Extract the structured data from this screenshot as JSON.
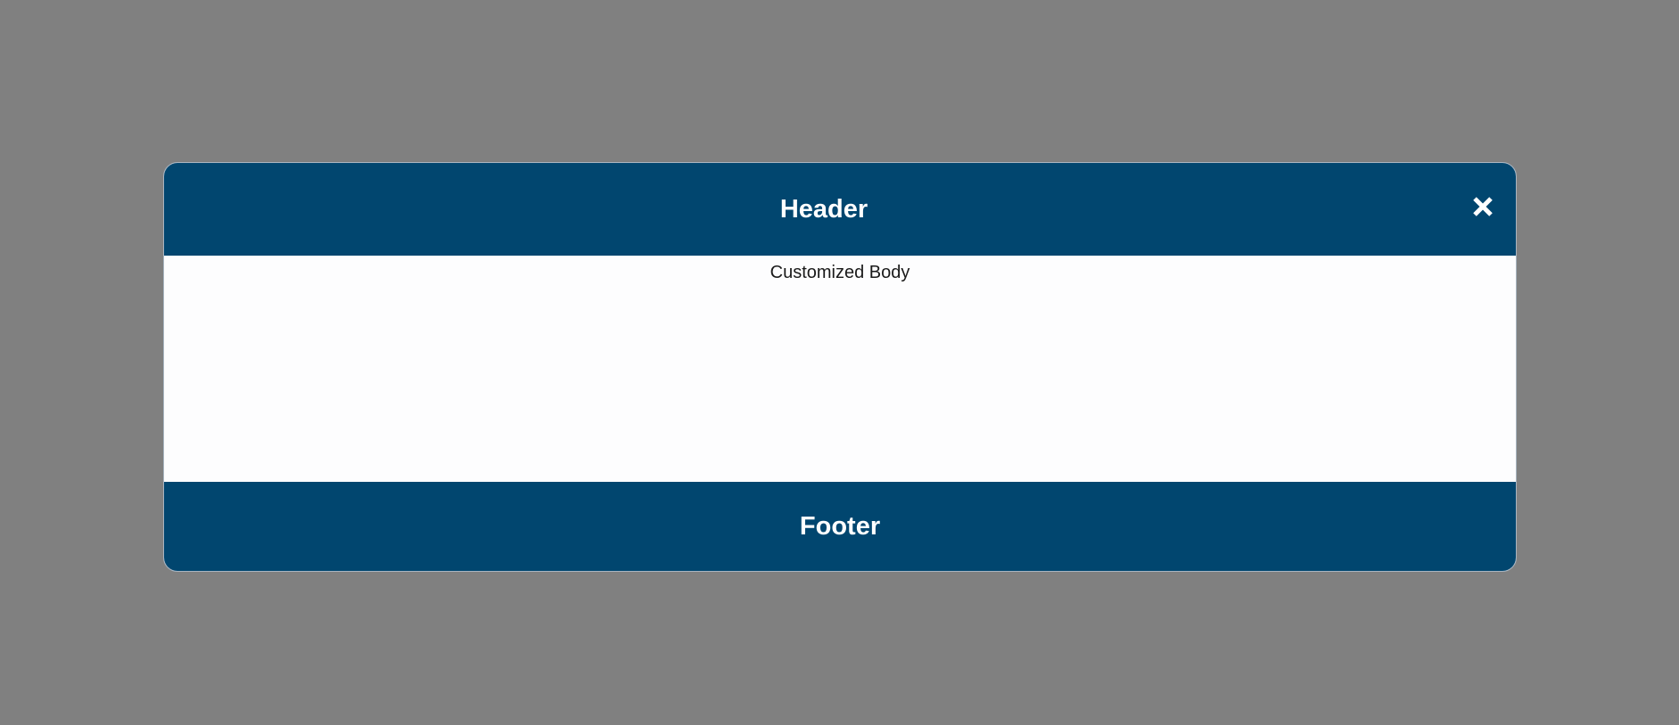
{
  "colors": {
    "backdrop": "#808080",
    "header_background": "#01466f",
    "footer_background": "#01466f",
    "body_background": "#fdfdfe",
    "header_text": "#ffffff"
  },
  "modal": {
    "header": {
      "title": "Header",
      "close_icon": "close-icon"
    },
    "body": {
      "text": "Customized Body"
    },
    "footer": {
      "title": "Footer"
    }
  }
}
